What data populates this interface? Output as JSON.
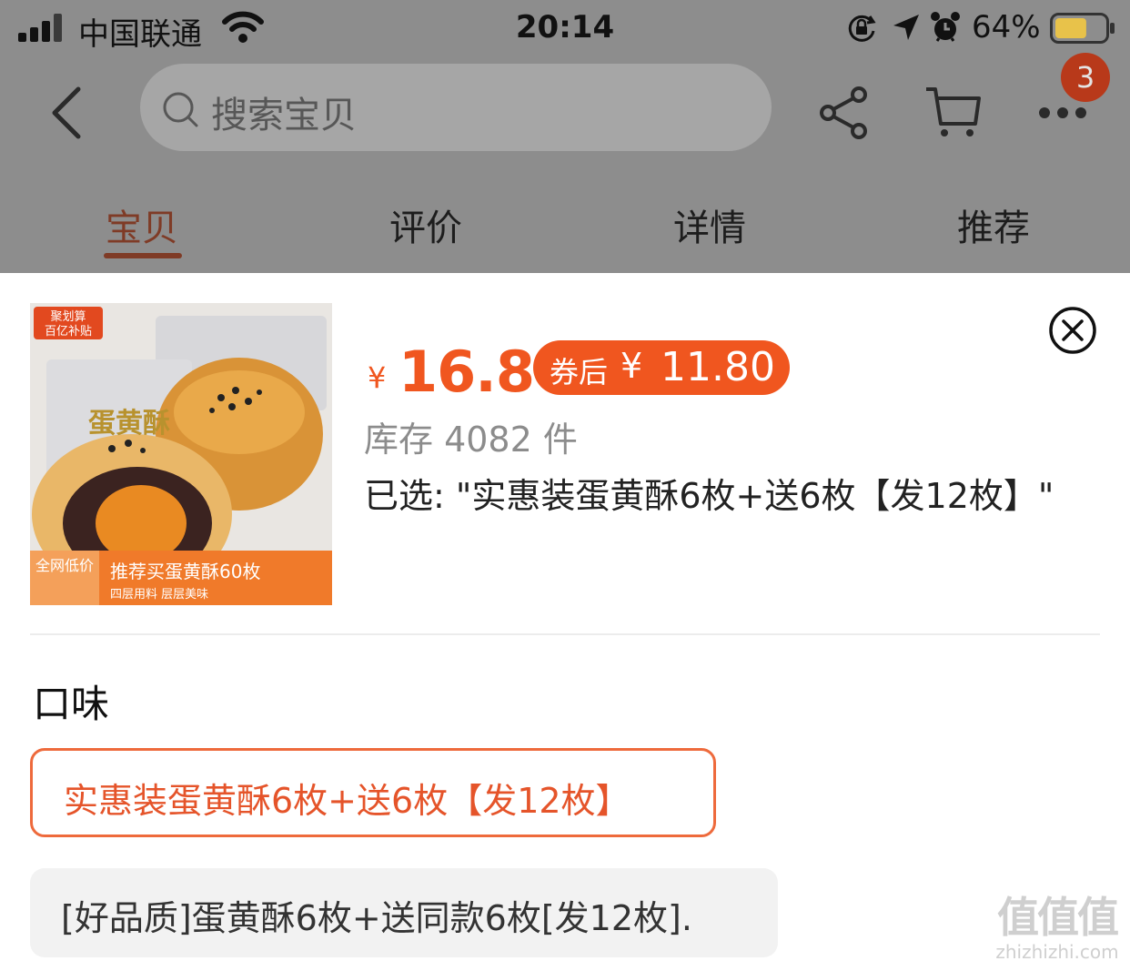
{
  "status_bar": {
    "carrier": "中国联通",
    "time": "20:14",
    "battery_percent": "64%",
    "battery_level": 0.64,
    "icons": [
      "signal-icon",
      "wifi-icon",
      "orientation-lock-icon",
      "location-icon",
      "alarm-icon",
      "battery-icon"
    ]
  },
  "nav": {
    "search_placeholder": "搜索宝贝",
    "cart_badge": "3",
    "icons": [
      "back-icon",
      "search-icon",
      "share-icon",
      "cart-icon",
      "more-icon"
    ]
  },
  "tabs": [
    {
      "label": "宝贝",
      "active": true
    },
    {
      "label": "评价",
      "active": false
    },
    {
      "label": "详情",
      "active": false
    },
    {
      "label": "推荐",
      "active": false
    }
  ],
  "sheet": {
    "thumbnail": {
      "top_badge_line1": "聚划算",
      "top_badge_line2": "百亿补贴",
      "product_text": "蛋黄酥",
      "bottom_badge": "全网低价",
      "bottom_line1": "推荐买蛋黄酥60枚",
      "bottom_line2": "四层用料 层层美味"
    },
    "price_symbol": "¥",
    "price": "16.8",
    "coupon_label": "券后",
    "coupon_symbol": "¥",
    "coupon_price": "11.80",
    "stock": "库存 4082 件",
    "selected_text": "已选: \"实惠装蛋黄酥6枚+送6枚【发12枚】\"",
    "flavor_title": "口味",
    "options": [
      {
        "label": "实惠装蛋黄酥6枚+送6枚【发12枚】",
        "selected": true
      },
      {
        "label": "[好品质]蛋黄酥6枚+送同款6枚[发12枚].",
        "selected": false
      }
    ]
  },
  "watermark": {
    "logo": "值值值",
    "site": "zhizhizhi.com"
  },
  "colors": {
    "accent": "#f0561f",
    "dim_overlay": "#8d8d8d",
    "badge": "#b8391a"
  }
}
